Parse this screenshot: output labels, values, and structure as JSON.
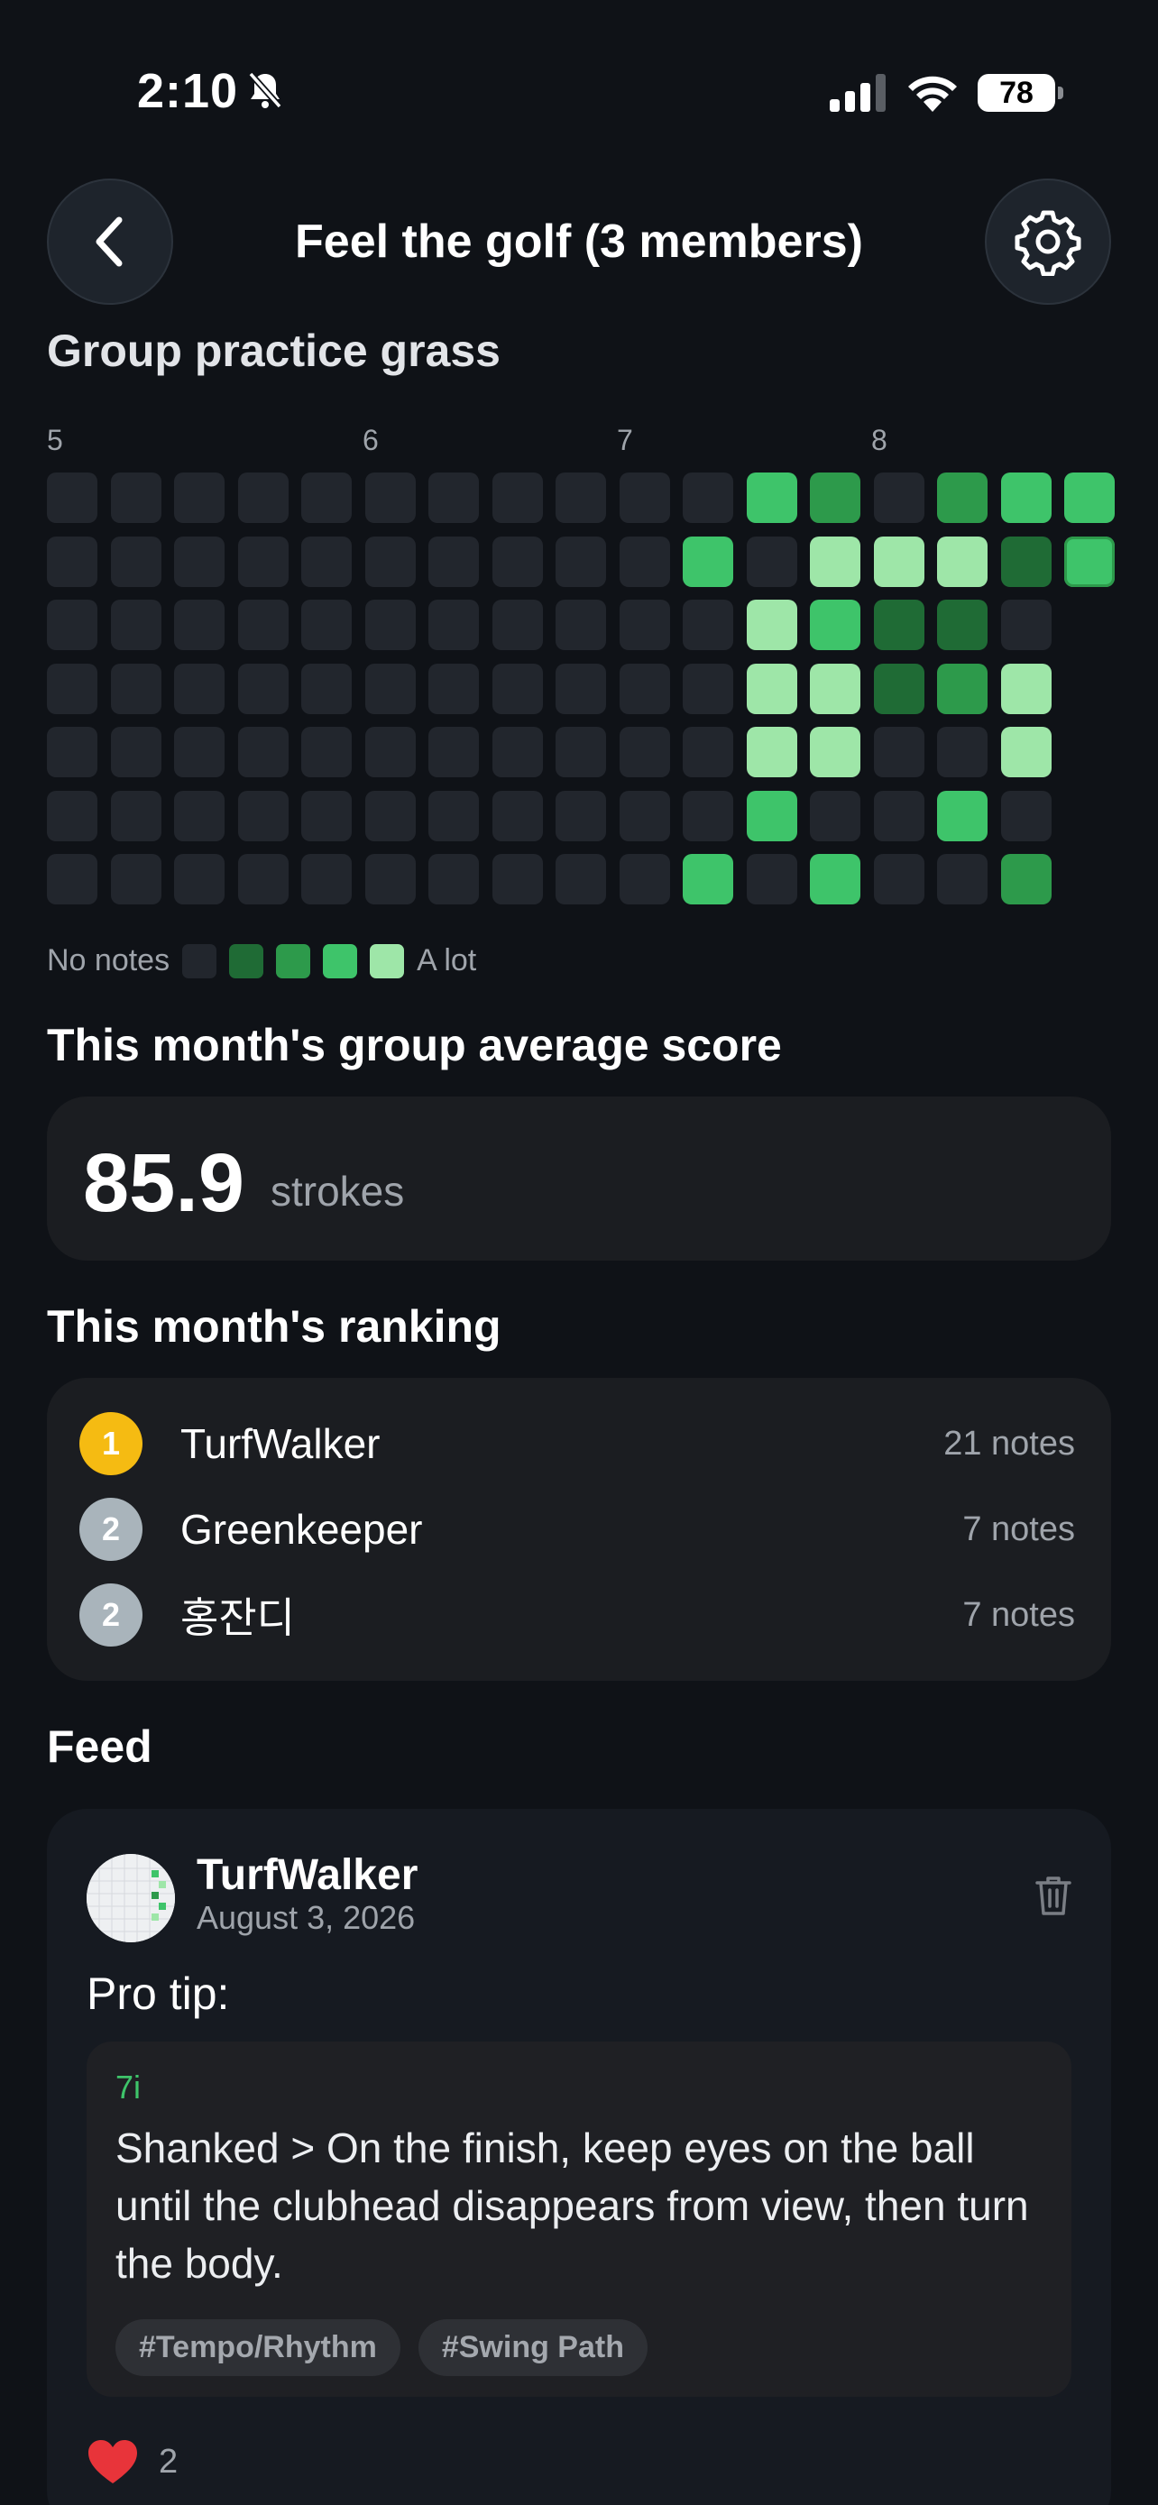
{
  "status_bar": {
    "time": "2:10",
    "battery": "78"
  },
  "header": {
    "title": "Feel the golf (3 members)"
  },
  "grass": {
    "title": "Group practice grass",
    "month_labels": [
      "5",
      "6",
      "7",
      "8"
    ],
    "legend": {
      "low": "No notes",
      "high": "A lot"
    },
    "levels": [
      [
        0,
        0,
        0,
        0,
        0,
        0,
        0,
        0,
        0,
        0,
        0,
        3,
        2,
        0,
        2,
        3,
        3
      ],
      [
        0,
        0,
        0,
        0,
        0,
        0,
        0,
        0,
        0,
        0,
        3,
        0,
        4,
        4,
        4,
        1,
        3
      ],
      [
        0,
        0,
        0,
        0,
        0,
        0,
        0,
        0,
        0,
        0,
        0,
        4,
        3,
        1,
        1,
        0,
        -1
      ],
      [
        0,
        0,
        0,
        0,
        0,
        0,
        0,
        0,
        0,
        0,
        0,
        4,
        4,
        1,
        2,
        4,
        -1
      ],
      [
        0,
        0,
        0,
        0,
        0,
        0,
        0,
        0,
        0,
        0,
        0,
        4,
        4,
        0,
        0,
        4,
        -1
      ],
      [
        0,
        0,
        0,
        0,
        0,
        0,
        0,
        0,
        0,
        0,
        0,
        3,
        0,
        0,
        3,
        0,
        -1
      ],
      [
        0,
        0,
        0,
        0,
        0,
        0,
        0,
        0,
        0,
        0,
        3,
        0,
        3,
        0,
        0,
        2,
        -1
      ]
    ],
    "colors": [
      "#22262d",
      "#1f6b35",
      "#2d9a4b",
      "#3ec46a",
      "#9ee6a8"
    ]
  },
  "average": {
    "title": "This month's group average score",
    "value": "85.9",
    "unit": "strokes"
  },
  "ranking": {
    "title": "This month's ranking",
    "rows": [
      {
        "rank": "1",
        "name": "TurfWalker",
        "notes": "21 notes",
        "badge_color": "#f5bb12"
      },
      {
        "rank": "2",
        "name": "Greenkeeper",
        "notes": "7 notes",
        "badge_color": "#a9b4bb"
      },
      {
        "rank": "2",
        "name": "홍잔디",
        "notes": "7 notes",
        "badge_color": "#a9b4bb"
      }
    ]
  },
  "feed": {
    "title": "Feed",
    "post": {
      "author": "TurfWalker",
      "date": "August 3, 2026",
      "text": "Pro tip:",
      "club": "7i",
      "note": "Shanked > On the finish, keep eyes on the ball until the clubhead disappears from view, then turn the body.",
      "tags": [
        "#Tempo/Rhythm",
        "#Swing Path"
      ],
      "likes": "2"
    }
  }
}
